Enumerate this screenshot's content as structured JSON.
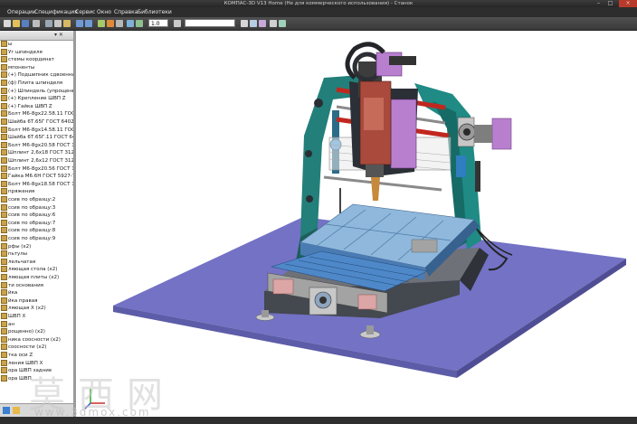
{
  "window": {
    "title": "КОМПАС-3D V13 Home (Не для коммерческого использования) - Станок",
    "controls": [
      "–",
      "□",
      "×"
    ]
  },
  "menu": {
    "items": [
      "Операции",
      "Спецификация",
      "Сервис",
      "Окно",
      "Справка",
      "Библиотеки"
    ]
  },
  "toolbar": {
    "scale_value": "1.0",
    "icons": [
      "new-icon",
      "open-icon",
      "save-icon",
      "print-icon",
      "cut-icon",
      "copy-icon",
      "paste-icon",
      "undo-icon",
      "redo-icon",
      "zoom-icon",
      "rotate-icon",
      "pan-icon",
      "view-icon",
      "shade-icon",
      "wire-icon"
    ]
  },
  "tree": {
    "header_pin": "▾ ✕",
    "header_close": "×",
    "items": [
      "ы",
      "Уг шпинделя",
      "стемы координат",
      "мпоненты",
      "(+) Подшипник сдвоенный (",
      "(ф) Плита шпинделя",
      "(+) Шпиндель (упрощенно)",
      "(+) Крепление ШВП Z",
      "(+) Гайка ШВП Z",
      "Болт М6-8gx22.58.11 ГОСТ 1...",
      "Шайба 6Т.65Г ГОСТ 6402-70",
      "Болт М6-8gx14.58.11 ГОСТ 1...",
      "Шайба 6Т.65Г.11 ГОСТ 6402",
      "Болт М6-8gx20.58 ГОСТ 1559",
      "Шплинт 2,6х18 ГОСТ 3128-70",
      "Шплинт 2,6х12 ГОСТ 3128-70",
      "Болт М6-8gx20.56 ГОСТ 1559",
      "Гайка М6.6Н ГОСТ 5927-70",
      "Болт М6-8gx18.58 ГОСТ 1559",
      "пряжения",
      "ссив по образцу:2",
      "ссив по образцу:3",
      "ссив по образцу:6",
      "ссив по образцу:7",
      "ссив по образцу:8",
      "ссив по образцу:9",
      "рфы (x2)",
      "пьтулы",
      "лельчатая",
      "ляющая стола (x2)",
      "ляющая плиты (x2)",
      "ти основания",
      "йка",
      "йка правая",
      "ляющая X (x2)",
      "ШВП X",
      "ан",
      "рощенно) (x2)",
      "ника соосности (x2)",
      "соосности (x2)",
      "тка оси Z",
      "ления ШВП X",
      "ора ШВП задние",
      "ора ШВП"
    ]
  },
  "watermark": {
    "chars": [
      "莫",
      "西",
      "网"
    ],
    "url": "www.3dmox.com"
  },
  "colors": {
    "frame_teal": "#1f8b84",
    "plate_blue": "#7574c6",
    "motor_violet": "#b97fcf",
    "spindle_red": "#a94a3c",
    "table_blue": "#8fb8dc",
    "rod_red": "#c1271f"
  }
}
